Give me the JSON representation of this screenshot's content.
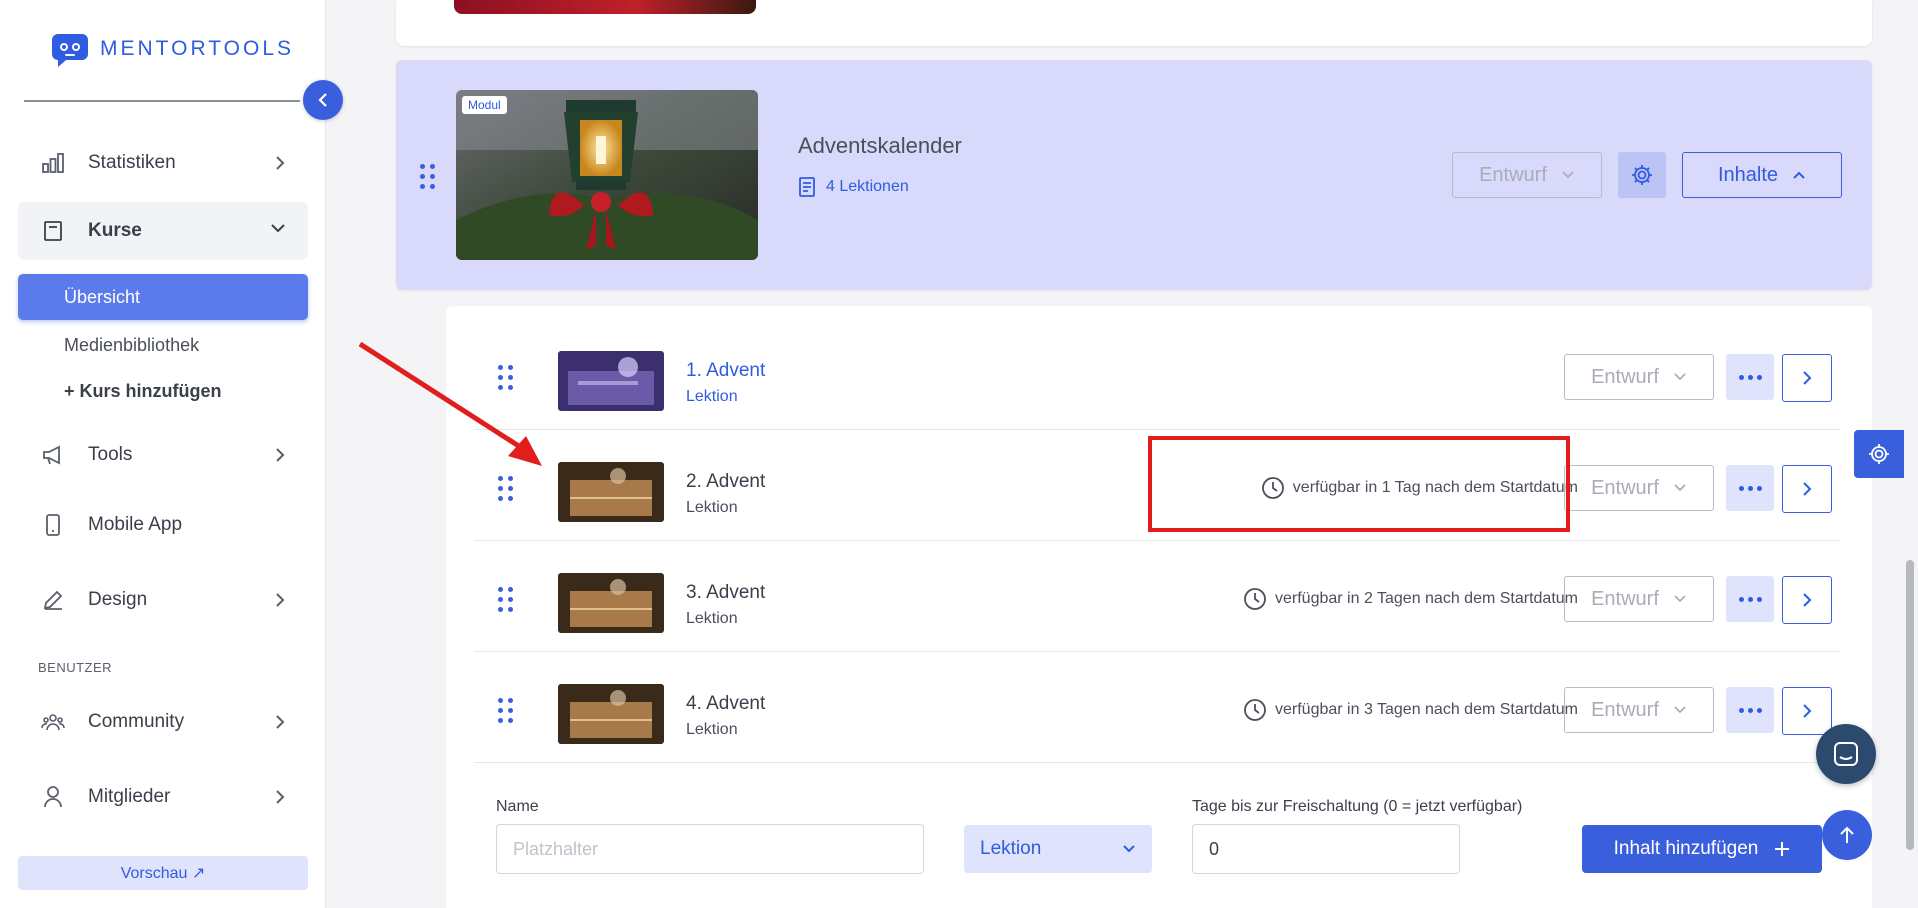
{
  "brand": {
    "name": "MENTORTOOLS"
  },
  "sidebar": {
    "items": [
      {
        "label": "Statistiken"
      },
      {
        "label": "Kurse"
      },
      {
        "label": "Tools"
      },
      {
        "label": "Mobile App"
      },
      {
        "label": "Design"
      },
      {
        "label": "Community"
      },
      {
        "label": "Mitglieder"
      }
    ],
    "kurse_sub": [
      {
        "label": "Übersicht"
      },
      {
        "label": "Medienbibliothek"
      },
      {
        "label": "+ Kurs hinzufügen"
      }
    ],
    "section_benutzer": "BENUTZER",
    "preview_label": "Vorschau ↗"
  },
  "module": {
    "tag": "Modul",
    "title": "Adventskalender",
    "lesson_count": "4 Lektionen",
    "status": "Entwurf",
    "contents_label": "Inhalte"
  },
  "lessons": [
    {
      "title": "1. Advent",
      "type": "Lektion",
      "availability": "",
      "status": "Entwurf"
    },
    {
      "title": "2. Advent",
      "type": "Lektion",
      "availability": "verfügbar in 1 Tag nach dem Startdatum",
      "status": "Entwurf"
    },
    {
      "title": "3. Advent",
      "type": "Lektion",
      "availability": "verfügbar in 2 Tagen nach dem Startdatum",
      "status": "Entwurf"
    },
    {
      "title": "4. Advent",
      "type": "Lektion",
      "availability": "verfügbar in 3 Tagen nach dem Startdatum",
      "status": "Entwurf"
    }
  ],
  "form": {
    "name_label": "Name",
    "name_placeholder": "Platzhalter",
    "type_value": "Lektion",
    "days_label": "Tage bis zur Freischaltung (0 = jetzt verfügbar)",
    "days_value": "0",
    "add_label": "Inhalt hinzufügen"
  },
  "colors": {
    "accent": "#3a5fdc",
    "module_bg": "#d9d9fb",
    "highlight": "#e21d1d"
  }
}
